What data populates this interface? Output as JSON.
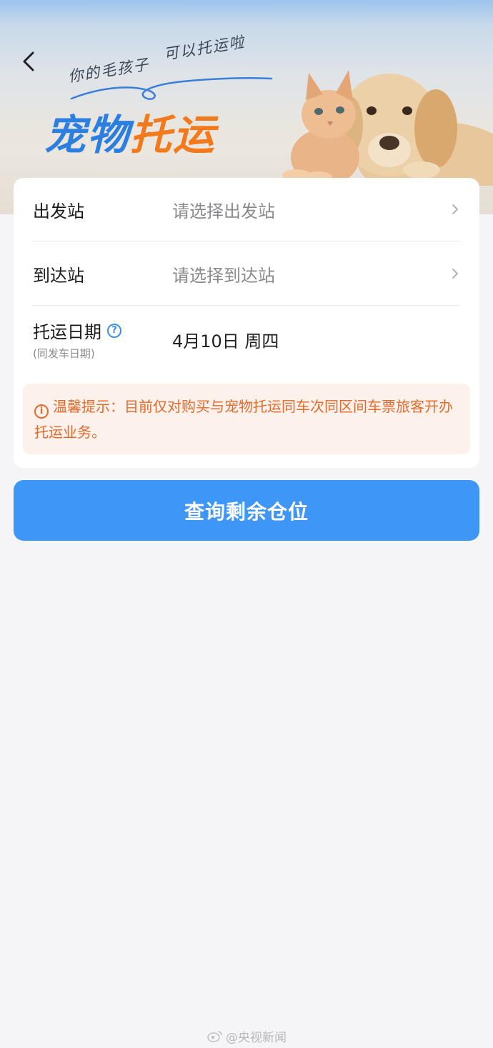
{
  "header": {
    "slogan_part1": "你的毛孩子",
    "slogan_part2": "可以托运啦",
    "title_part1": "宠物",
    "title_part2": "托运"
  },
  "form": {
    "departure": {
      "label": "出发站",
      "placeholder": "请选择出发站"
    },
    "arrival": {
      "label": "到达站",
      "placeholder": "请选择到达站"
    },
    "date": {
      "label": "托运日期",
      "sub_label": "(同发车日期)",
      "value": "4月10日 周四"
    }
  },
  "tip": {
    "text": "温馨提示：目前仅对购买与宠物托运同车次同区间车票旅客开办托运业务。"
  },
  "actions": {
    "query_label": "查询剩余仓位"
  },
  "watermark": {
    "text": "@央视新闻"
  },
  "colors": {
    "accent_blue": "#3e97f7",
    "title_blue": "#2a7fe0",
    "title_orange": "#f27a1c",
    "tip_text": "#e36a2c",
    "tip_bg": "#fdf1ec"
  }
}
